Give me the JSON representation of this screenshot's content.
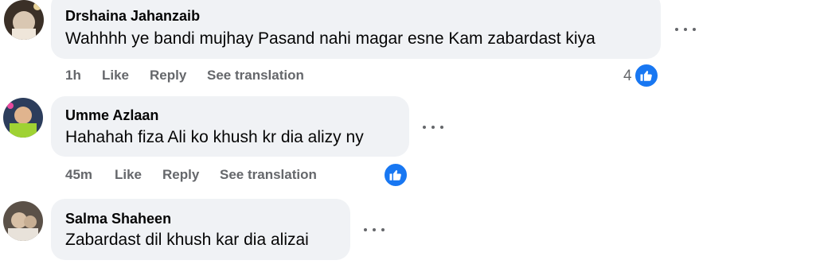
{
  "comments": [
    {
      "author": "Drshaina Jahanzaib",
      "text": "Wahhhh ye bandi mujhay Pasand nahi magar esne Kam zabardast kiya",
      "time": "1h",
      "like_label": "Like",
      "reply_label": "Reply",
      "translate_label": "See translation",
      "reaction_count": "4"
    },
    {
      "author": "Umme Azlaan",
      "text": "Hahahah fiza Ali ko khush kr dia alizy ny",
      "time": "45m",
      "like_label": "Like",
      "reply_label": "Reply",
      "translate_label": "See translation"
    },
    {
      "author": "Salma Shaheen",
      "text": "Zabardast dil khush kar dia alizai"
    }
  ],
  "colors": {
    "bubble": "#f0f2f5",
    "meta": "#65676b",
    "like_blue": "#1877f2"
  },
  "icons": {
    "more": "more-options-icon",
    "like": "thumbs-up-icon"
  }
}
